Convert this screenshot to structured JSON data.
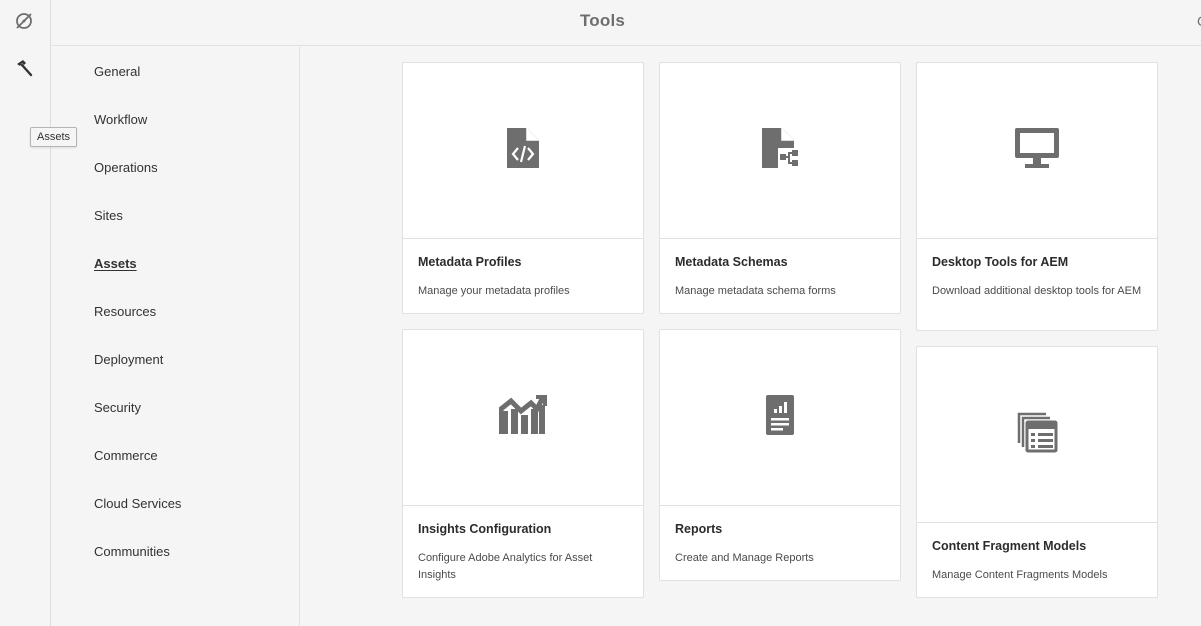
{
  "header": {
    "title": "Tools",
    "edge_glyph": "C"
  },
  "rail": {
    "items": [
      {
        "icon": "compass-off-icon"
      },
      {
        "icon": "hammer-icon"
      }
    ],
    "tooltip": "Assets"
  },
  "nav": {
    "items": [
      {
        "label": "General"
      },
      {
        "label": "Workflow"
      },
      {
        "label": "Operations"
      },
      {
        "label": "Sites"
      },
      {
        "label": "Assets",
        "active": true
      },
      {
        "label": "Resources"
      },
      {
        "label": "Deployment"
      },
      {
        "label": "Security"
      },
      {
        "label": "Commerce"
      },
      {
        "label": "Cloud Services"
      },
      {
        "label": "Communities"
      }
    ]
  },
  "cards": [
    {
      "title": "Metadata Profiles",
      "description": "Manage your metadata profiles",
      "icon": "file-code-icon"
    },
    {
      "title": "Metadata Schemas",
      "description": "Manage metadata schema forms",
      "icon": "file-tree-icon"
    },
    {
      "title": "Desktop Tools for AEM",
      "description": "Download additional desktop tools for AEM",
      "icon": "monitor-icon"
    },
    {
      "title": "Insights Configuration",
      "description": "Configure Adobe Analytics for Asset Insights",
      "icon": "chart-trend-icon"
    },
    {
      "title": "Reports",
      "description": "Create and Manage Reports",
      "icon": "report-icon"
    },
    {
      "title": "Content Fragment Models",
      "description": "Manage Content Fragments Models",
      "icon": "fragment-models-icon"
    }
  ],
  "colors": {
    "icon": "#6e6e6e",
    "background": "#f5f5f5",
    "card": "#ffffff",
    "border": "#e1e1e1"
  }
}
